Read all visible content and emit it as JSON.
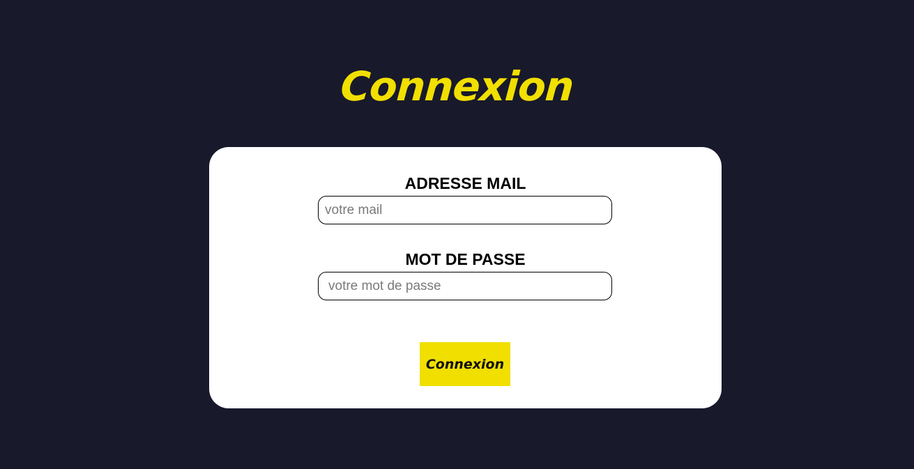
{
  "colors": {
    "background": "#18192b",
    "accent": "#f1df00",
    "card": "#ffffff",
    "text": "#000000"
  },
  "header": {
    "title": "Connexion"
  },
  "form": {
    "email": {
      "label": "ADRESSE MAIL",
      "placeholder": "votre mail",
      "value": ""
    },
    "password": {
      "label": "MOT DE PASSE",
      "placeholder": "votre mot de passe",
      "value": ""
    },
    "submit_label": "Connexion"
  }
}
